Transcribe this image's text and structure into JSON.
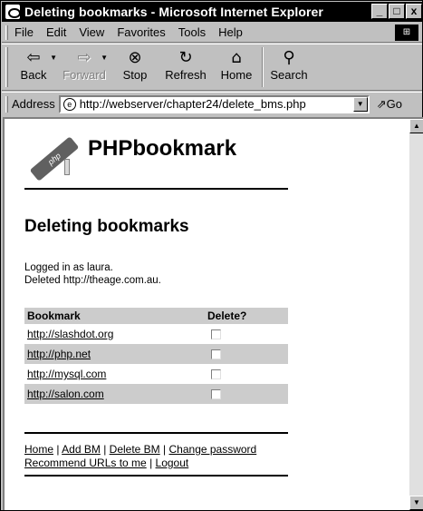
{
  "window": {
    "title": "Deleting bookmarks - Microsoft Internet Explorer",
    "buttons": {
      "minimize": "_",
      "maximize": "□",
      "close": "x"
    }
  },
  "menubar": {
    "items": [
      {
        "label": "File"
      },
      {
        "label": "Edit"
      },
      {
        "label": "View"
      },
      {
        "label": "Favorites"
      },
      {
        "label": "Tools"
      },
      {
        "label": "Help"
      }
    ]
  },
  "toolbar": {
    "back": {
      "label": "Back",
      "icon": "⇦"
    },
    "forward": {
      "label": "Forward",
      "icon": "⇨"
    },
    "stop": {
      "label": "Stop",
      "icon": "⊗"
    },
    "refresh": {
      "label": "Refresh",
      "icon": "↻"
    },
    "home": {
      "label": "Home",
      "icon": "⌂"
    },
    "search": {
      "label": "Search",
      "icon": "⚲"
    }
  },
  "address": {
    "label": "Address",
    "url": "http://webserver/chapter24/delete_bms.php",
    "go_label": "Go"
  },
  "page": {
    "logo_text": "PHPbookmark",
    "logo_badge": "php",
    "heading": "Deleting bookmarks",
    "status_lines": [
      "Logged in as laura.",
      "Deleted http://theage.com.au."
    ],
    "table": {
      "headers": [
        "Bookmark",
        "Delete?"
      ],
      "rows": [
        {
          "url": "http://slashdot.org",
          "checked": false
        },
        {
          "url": "http://php.net",
          "checked": false
        },
        {
          "url": "http://mysql.com",
          "checked": false
        },
        {
          "url": "http://salon.com",
          "checked": false
        }
      ]
    },
    "footer": {
      "home": "Home",
      "add_bm": "Add BM",
      "delete_bm": "Delete BM",
      "change_password": "Change password",
      "recommend": "Recommend URLs to me",
      "logout": "Logout",
      "sep": "|"
    }
  }
}
